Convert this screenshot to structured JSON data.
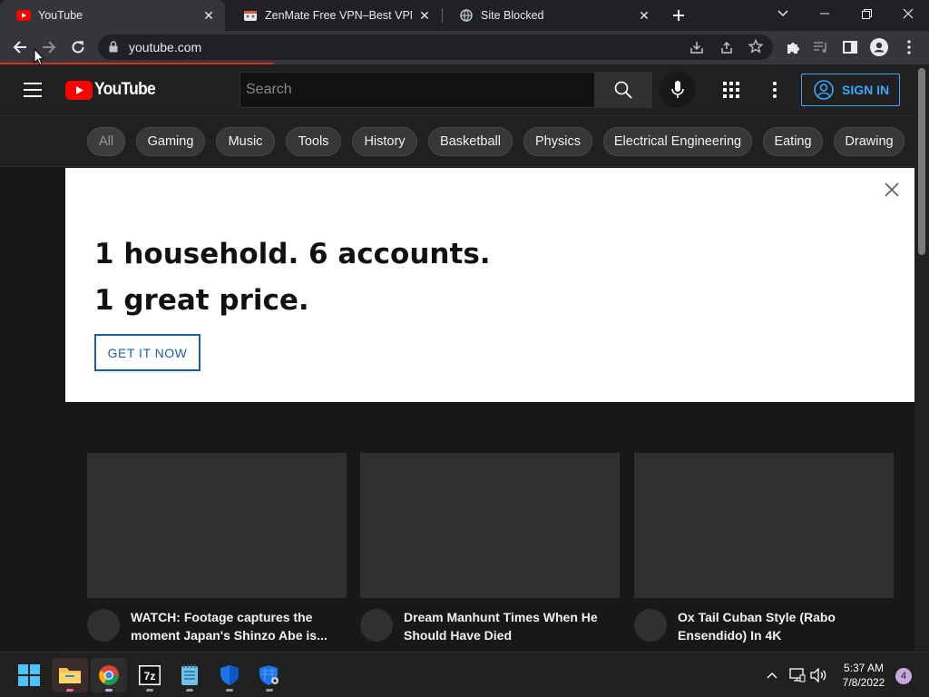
{
  "browser": {
    "tabs": [
      {
        "title": "YouTube",
        "favicon": "youtube-favicon",
        "active": true
      },
      {
        "title": "ZenMate Free VPN–Best VPN for",
        "favicon": "zenmate-favicon",
        "active": false
      },
      {
        "title": "Site Blocked",
        "favicon": "globe-favicon",
        "active": false
      }
    ],
    "url": "youtube.com"
  },
  "youtube": {
    "logo_text": "YouTube",
    "search_placeholder": "Search",
    "sign_in_label": "SIGN IN",
    "chips": [
      "All",
      "Gaming",
      "Music",
      "Tools",
      "History",
      "Basketball",
      "Physics",
      "Electrical Engineering",
      "Eating",
      "Drawing"
    ],
    "selected_chip": "All",
    "promo": {
      "headline": "1 household. 6 accounts. 1 great price.",
      "cta_label": "GET IT NOW"
    },
    "videos": [
      {
        "title": "WATCH: Footage captures the moment Japan's Shinzo Abe is..."
      },
      {
        "title": "Dream Manhunt Times When He Should Have Died"
      },
      {
        "title": "Ox Tail Cuban Style (Rabo Ensendido) In 4K"
      }
    ]
  },
  "taskbar": {
    "apps": [
      "windows-start",
      "file-explorer",
      "chrome",
      "7zip",
      "notepad",
      "windows-security",
      "settings-security"
    ],
    "time": "5:37 AM",
    "date": "7/8/2022",
    "notification_count": "4"
  },
  "colors": {
    "accent_blue": "#3ea6ff",
    "youtube_red": "#ff0000",
    "promo_cta": "#1f5f9e",
    "loading_bar": "#d93025"
  }
}
